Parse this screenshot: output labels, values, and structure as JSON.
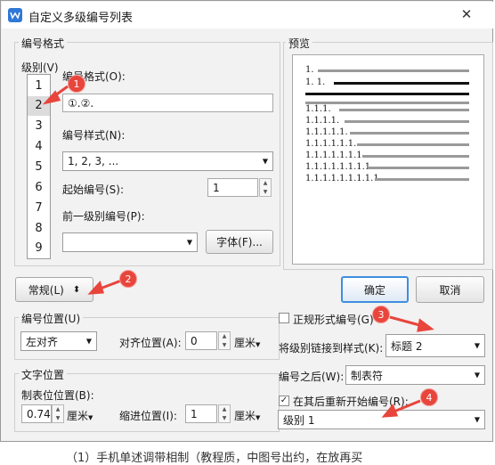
{
  "window": {
    "title": "自定义多级编号列表",
    "close_glyph": "✕"
  },
  "number_format": {
    "group_label": "编号格式",
    "level_label": "级别(V)",
    "levels": [
      "1",
      "2",
      "3",
      "4",
      "5",
      "6",
      "7",
      "8",
      "9"
    ],
    "selected_level": "2",
    "format_label": "编号格式(O):",
    "format_value": "①.②.",
    "style_label": "编号样式(N):",
    "style_value": "1, 2, 3, ...",
    "start_label": "起始编号(S):",
    "start_value": "1",
    "prev_level_label": "前一级别编号(P):",
    "prev_level_value": "",
    "font_button": "字体(F)..."
  },
  "preview": {
    "label": "预览",
    "lines": [
      "1.",
      "1. 1.",
      "1.1.1.",
      "1.1.1.1.",
      "1.1.1.1.1.",
      "1.1.1.1.1.1.",
      "1.1.1.1.1.1.1.",
      "1.1.1.1.1.1.1.1.",
      "1.1.1.1.1.1.1.1.1."
    ]
  },
  "buttons": {
    "normal": "常规(L)",
    "normal_icon": "⬍",
    "ok": "确定",
    "cancel": "取消"
  },
  "number_position": {
    "group_label": "编号位置(U)",
    "align_value": "左对齐",
    "align_pos_label": "对齐位置(A):",
    "align_pos_value": "0",
    "unit": "厘米"
  },
  "text_position": {
    "group_label": "文字位置",
    "tab_label": "制表位位置(B):",
    "tab_value": "0.74",
    "unit": "厘米",
    "indent_label": "缩进位置(I):",
    "indent_value": "1",
    "indent_unit": "厘米"
  },
  "options": {
    "legal_label": "正规形式编号(G)",
    "legal_checked": false,
    "link_label": "将级别链接到样式(K):",
    "link_value": "标题 2",
    "after_label": "编号之后(W):",
    "after_value": "制表符",
    "restart_label": "在其后重新开始编号(R):",
    "restart_checked": true,
    "restart_value": "级别 1"
  },
  "annotations": [
    "1",
    "2",
    "3",
    "4"
  ],
  "bottom_text": "（1）手机单述调带相制（教程质，中图号出约，在放再买"
}
